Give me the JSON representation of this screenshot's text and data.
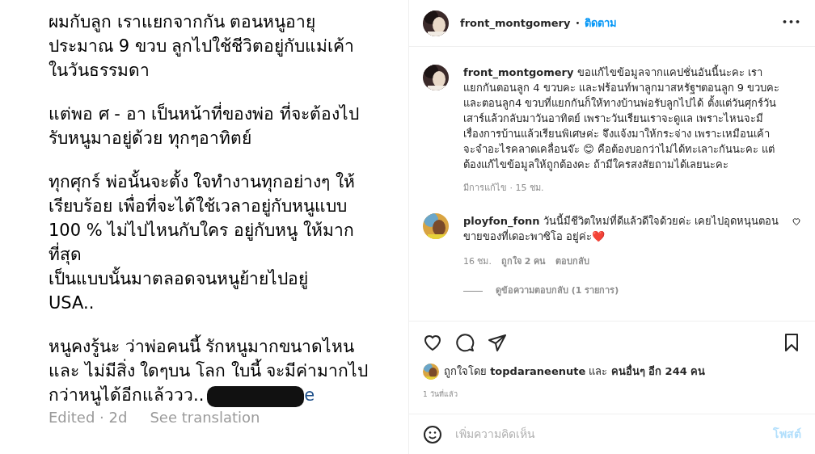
{
  "post_image": {
    "paragraphs": [
      [
        "ผมกับลูก เราแยกจากกัน ตอนหนูอายุ",
        "ประมาณ 9 ขวบ ลูกไปใช้ชีวิตอยู่กับแม่เค้า",
        "ในวันธรรมดา"
      ],
      [
        "แต่พอ ศ - อา เป็นหน้าที่ของพ่อ ที่จะต้องไป",
        "รับหนูมาอยู่ด้วย ทุกๆอาทิตย์"
      ],
      [
        "ทุกศุกร์ พ่อนั้นจะตั้ง ใจทำงานทุกอย่างๆ ให้",
        "เรียบร้อย เพื่อที่จะได้ใช้เวลาอยู่กับหนูแบบ",
        "100 % ไม่ไปไหนกับใคร อยู่กับหนู ให้มาก",
        "ที่สุด",
        "เป็นแบบนั้นมาตลอดจนหนูย้ายไปอยู่",
        "USA.."
      ],
      [
        "หนูคงรู้นะ ว่าพ่อคนนี้ รักหนูมากขนาดไหน",
        "และ ไม่มีสิ่ง ใดๆบน โลก ใบนี้ จะมีค่ามากไป",
        "กว่าหนูได้อีกแล้ววว.."
      ]
    ],
    "hidden_tail": "e",
    "edited": "Edited · 2d",
    "see_translation": "See translation"
  },
  "header": {
    "username": "front_montgomery",
    "dot": "•",
    "follow": "ติดตาม",
    "more": "•••"
  },
  "caption": {
    "text": "**front_montgomery** ขอแก้ไขข้อมูลจากแคปชั่นอันนี้นะคะ เราแยกกันตอนลูก 4 ขวบคะ และฟร้อนท์พาลูกมาสหรัฐฯตอนลูก 9 ขวบคะ และตอนลูก4 ขวบที่แยกกันก็ให้ทางบ้านพ่อรับลูกไปได้ ตั้งแต่วันศุกร์วันเสาร์แล้วกลับมาวันอาทิตย์ เพราะวันเรียนเราจะดูแล เพราะไหนจะมีเรื่องการบ้านแล้วเรียนพิเศษค่ะ จึงแจ้งมาให้กระจ่าง เพราะเหมือนเค้าจะจำอะไรคลาดเคลื่อนจ๊ะ 😊 คือต้องบอกว่าไม่ได้ทะเลาะกันนะคะ แต่ต้องแก้ไขข้อมูลให้ถูกต้องคะ ถ้ามีใครสงสัยถามได้เลยนะคะ",
    "meta": "มีการแก้ไข · 15 ชม."
  },
  "comments": [
    {
      "text": "**ployfon_fonn** วันนี้มีชีวิตใหม่ที่ดีแล้วดีใจด้วยค่ะ เคยไปอุดหนุนตอนขายของที่เดอะพาซิโอ อยู่ค่ะ❤️",
      "time": "16 ชม.",
      "likes": "ถูกใจ 2 คน",
      "reply": "ตอบกลับ",
      "view_replies": "ดูข้อความตอบกลับ (1 รายการ)",
      "liked": false
    }
  ],
  "likes": {
    "text": "ถูกใจโดย **topdaraneenute** และ **คนอื่นๆ อีก 244 คน**",
    "age": "1 วันที่แล้ว"
  },
  "add_comment": {
    "placeholder": "เพิ่มความคิดเห็น",
    "post": "โพสต์"
  }
}
